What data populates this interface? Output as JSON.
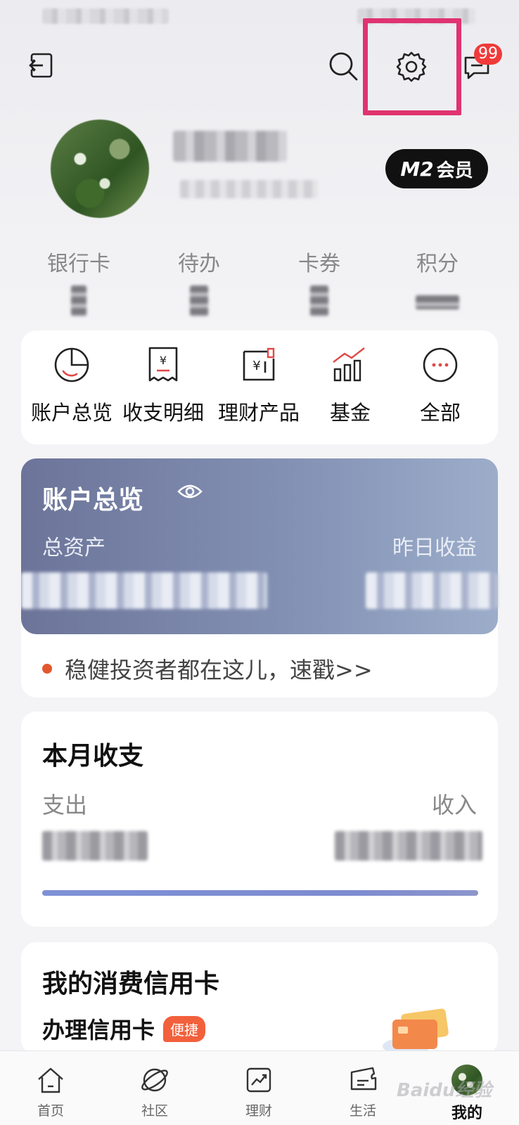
{
  "header": {
    "message_badge": "99"
  },
  "member": {
    "level": "M2",
    "label": "会员"
  },
  "stats": [
    {
      "label": "银行卡"
    },
    {
      "label": "待办"
    },
    {
      "label": "卡券"
    },
    {
      "label": "积分"
    }
  ],
  "quick_menu": [
    {
      "label": "账户总览",
      "icon": "pie-chart-icon"
    },
    {
      "label": "收支明细",
      "icon": "receipt-icon"
    },
    {
      "label": "理财产品",
      "icon": "finance-product-icon"
    },
    {
      "label": "基金",
      "icon": "fund-chart-icon"
    },
    {
      "label": "全部",
      "icon": "more-icon"
    }
  ],
  "overview": {
    "title": "账户总览",
    "total_assets_label": "总资产",
    "yesterday_earnings_label": "昨日收益",
    "promo_text": "稳健投资者都在这儿，速戳>>"
  },
  "monthly": {
    "title": "本月收支",
    "expense_label": "支出",
    "income_label": "收入"
  },
  "credit_card": {
    "title": "我的消费信用卡",
    "apply_label": "办理信用卡",
    "tag": "便捷"
  },
  "tabbar": [
    {
      "label": "首页",
      "icon": "home-icon"
    },
    {
      "label": "社区",
      "icon": "community-icon"
    },
    {
      "label": "理财",
      "icon": "wealth-icon"
    },
    {
      "label": "生活",
      "icon": "life-icon"
    },
    {
      "label": "我的",
      "icon": "avatar-icon",
      "active": true
    }
  ],
  "colors": {
    "highlight": "#e0336f",
    "badge": "#f03a3a",
    "overview_gradient_start": "#6c7499",
    "overview_gradient_end": "#9cadca",
    "promo_dot": "#e4572e",
    "tag": "#f2603c"
  },
  "watermark": "Baidu经验"
}
